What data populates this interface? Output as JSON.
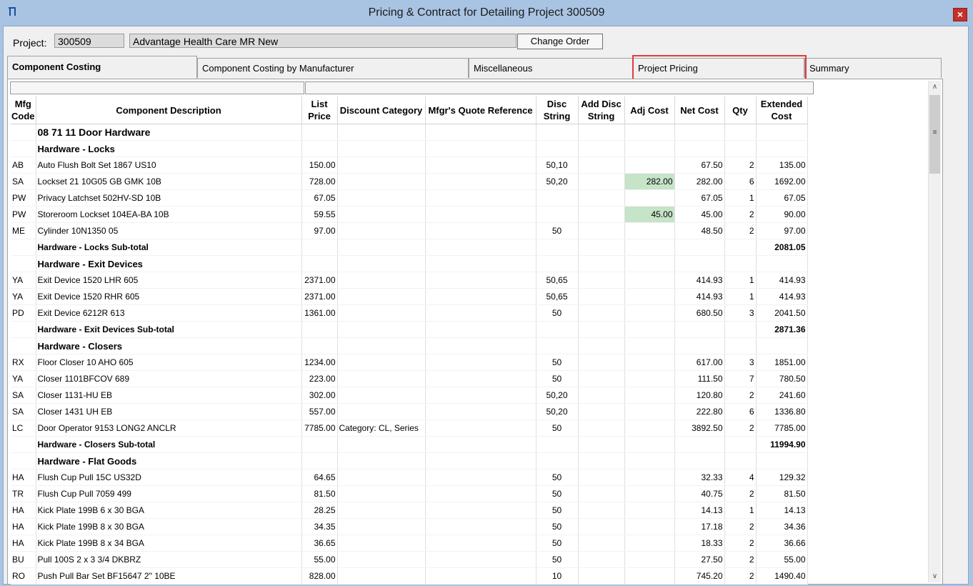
{
  "window": {
    "title": "Pricing & Contract for Detailing Project 300509",
    "close": "×",
    "icon": "app-logo-icon"
  },
  "project": {
    "label": "Project:",
    "number": "300509",
    "name": "Advantage Health Care MR New",
    "change_order": "Change Order"
  },
  "tabs": [
    {
      "label": "Component Costing",
      "active": true
    },
    {
      "label": "Component Costing by Manufacturer"
    },
    {
      "label": "Miscellaneous"
    },
    {
      "label": "Project Pricing",
      "highlighted": true
    },
    {
      "label": "Summary"
    }
  ],
  "columns": {
    "mfg": "Mfg Code",
    "desc": "Component Description",
    "list": "List Price",
    "disc_cat": "Discount Category",
    "quote": "Mfgr's Quote Reference",
    "disc_str": "Disc String",
    "add_disc": "Add Disc String",
    "adj": "Adj Cost",
    "net": "Net Cost",
    "qty": "Qty",
    "ext": "Extended Cost"
  },
  "rows": [
    {
      "type": "section",
      "desc": "08 71 11 Door Hardware"
    },
    {
      "type": "group",
      "desc": "Hardware - Locks"
    },
    {
      "type": "item",
      "mfg": "AB",
      "desc": "Auto Flush Bolt Set 1867 US10",
      "list": "150.00",
      "disc": "50,10",
      "net": "67.50",
      "qty": "2",
      "ext": "135.00"
    },
    {
      "type": "item",
      "mfg": "SA",
      "desc": "Lockset 21 10G05 GB GMK 10B",
      "list": "728.00",
      "disc": "50,20",
      "adj": "282.00",
      "net": "282.00",
      "qty": "6",
      "ext": "1692.00"
    },
    {
      "type": "item",
      "mfg": "PW",
      "desc": "Privacy Latchset 502HV-SD 10B",
      "list": "67.05",
      "net": "67.05",
      "qty": "1",
      "ext": "67.05"
    },
    {
      "type": "item",
      "mfg": "PW",
      "desc": "Storeroom Lockset 104EA-BA 10B",
      "list": "59.55",
      "adj": "45.00",
      "net": "45.00",
      "qty": "2",
      "ext": "90.00"
    },
    {
      "type": "item",
      "mfg": "ME",
      "desc": "Cylinder 10N1350 05",
      "list": "97.00",
      "disc": "50",
      "net": "48.50",
      "qty": "2",
      "ext": "97.00"
    },
    {
      "type": "subtotal",
      "desc": "Hardware - Locks  Sub-total",
      "ext": "2081.05"
    },
    {
      "type": "group",
      "desc": "Hardware - Exit Devices"
    },
    {
      "type": "item",
      "mfg": "YA",
      "desc": "Exit Device 1520 LHR 605",
      "list": "2371.00",
      "disc": "50,65",
      "net": "414.93",
      "qty": "1",
      "ext": "414.93"
    },
    {
      "type": "item",
      "mfg": "YA",
      "desc": "Exit Device 1520 RHR 605",
      "list": "2371.00",
      "disc": "50,65",
      "net": "414.93",
      "qty": "1",
      "ext": "414.93"
    },
    {
      "type": "item",
      "mfg": "PD",
      "desc": "Exit Device 6212R 613",
      "list": "1361.00",
      "disc": "50",
      "net": "680.50",
      "qty": "3",
      "ext": "2041.50"
    },
    {
      "type": "subtotal",
      "desc": "Hardware - Exit Devices  Sub-total",
      "ext": "2871.36"
    },
    {
      "type": "group",
      "desc": "Hardware - Closers"
    },
    {
      "type": "item",
      "mfg": "RX",
      "desc": "Floor Closer 10 AHO 605",
      "list": "1234.00",
      "disc": "50",
      "net": "617.00",
      "qty": "3",
      "ext": "1851.00"
    },
    {
      "type": "item",
      "mfg": "YA",
      "desc": "Closer 1101BFCOV 689",
      "list": "223.00",
      "disc": "50",
      "net": "111.50",
      "qty": "7",
      "ext": "780.50"
    },
    {
      "type": "item",
      "mfg": "SA",
      "desc": "Closer 1131-HU EB",
      "list": "302.00",
      "disc": "50,20",
      "net": "120.80",
      "qty": "2",
      "ext": "241.60"
    },
    {
      "type": "item",
      "mfg": "SA",
      "desc": "Closer 1431 UH EB",
      "list": "557.00",
      "disc": "50,20",
      "net": "222.80",
      "qty": "6",
      "ext": "1336.80"
    },
    {
      "type": "item",
      "mfg": "LC",
      "desc": "Door Operator 9153 LONG2 ANCLR",
      "list": "7785.00",
      "cat": "Category: CL, Series",
      "disc": "50",
      "net": "3892.50",
      "qty": "2",
      "ext": "7785.00"
    },
    {
      "type": "subtotal",
      "desc": "Hardware - Closers  Sub-total",
      "ext": "11994.90"
    },
    {
      "type": "group",
      "desc": "Hardware - Flat Goods"
    },
    {
      "type": "item",
      "mfg": "HA",
      "desc": "Flush Cup Pull 15C US32D",
      "list": "64.65",
      "disc": "50",
      "net": "32.33",
      "qty": "4",
      "ext": "129.32"
    },
    {
      "type": "item",
      "mfg": "TR",
      "desc": "Flush Cup Pull 7059 499",
      "list": "81.50",
      "disc": "50",
      "net": "40.75",
      "qty": "2",
      "ext": "81.50"
    },
    {
      "type": "item",
      "mfg": "HA",
      "desc": "Kick Plate 199B 6 x 30 BGA",
      "list": "28.25",
      "disc": "50",
      "net": "14.13",
      "qty": "1",
      "ext": "14.13"
    },
    {
      "type": "item",
      "mfg": "HA",
      "desc": "Kick Plate 199B 8 x 30 BGA",
      "list": "34.35",
      "disc": "50",
      "net": "17.18",
      "qty": "2",
      "ext": "34.36"
    },
    {
      "type": "item",
      "mfg": "HA",
      "desc": "Kick Plate 199B 8 x 34 BGA",
      "list": "36.65",
      "disc": "50",
      "net": "18.33",
      "qty": "2",
      "ext": "36.66"
    },
    {
      "type": "item",
      "mfg": "BU",
      "desc": "Pull 100S 2 x 3 3/4 DKBRZ",
      "list": "55.00",
      "disc": "50",
      "net": "27.50",
      "qty": "2",
      "ext": "55.00"
    },
    {
      "type": "item",
      "mfg": "RO",
      "desc": "Push Pull Bar Set BF15647 2\" 10BE",
      "list": "828.00",
      "disc": "10",
      "net": "745.20",
      "qty": "2",
      "ext": "1490.40"
    }
  ],
  "scrollbar": {
    "up": "∧",
    "down": "∨",
    "grip": "≡"
  },
  "colors": {
    "titlebar": "#a9c4e3",
    "adj_highlight": "#c6e4c8",
    "tab_highlight": "#e03c3c",
    "close": "#c4302b"
  }
}
